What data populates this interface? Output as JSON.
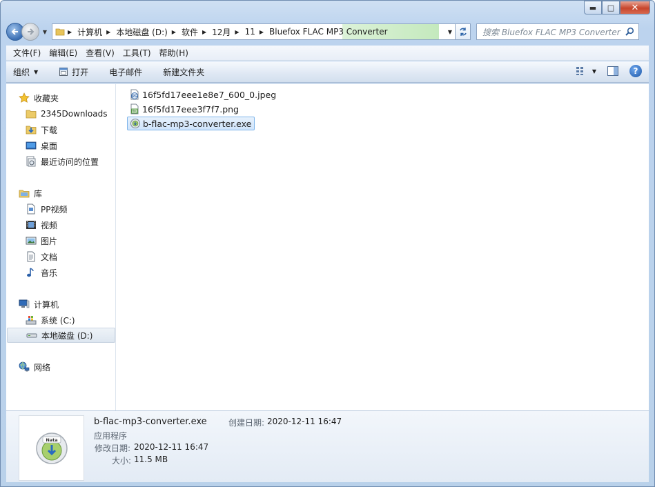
{
  "window": {
    "minimize": "▬",
    "maximize": "□",
    "close": "✕"
  },
  "address": {
    "crumbs": [
      "计算机",
      "本地磁盘 (D:)",
      "软件",
      "12月",
      "11",
      "Bluefox FLAC MP3 Converter"
    ]
  },
  "search": {
    "placeholder": "搜索 Bluefox FLAC MP3 Converter"
  },
  "menubar": {
    "file": "文件(F)",
    "edit": "编辑(E)",
    "view": "查看(V)",
    "tools": "工具(T)",
    "help": "帮助(H)"
  },
  "toolbar": {
    "organize": "组织",
    "open": "打开",
    "email": "电子邮件",
    "new_folder": "新建文件夹"
  },
  "navpane": {
    "favorites": "收藏夹",
    "fav_items": [
      "2345Downloads",
      "下载",
      "桌面",
      "最近访问的位置"
    ],
    "libraries": "库",
    "lib_items": [
      "PP视频",
      "视频",
      "图片",
      "文档",
      "音乐"
    ],
    "computer": "计算机",
    "comp_items": [
      "系统 (C:)",
      "本地磁盘 (D:)"
    ],
    "network": "网络"
  },
  "files": [
    {
      "name": "16f5fd17eee1e8e7_600_0.jpeg",
      "icon": "jpeg-file-icon"
    },
    {
      "name": "16f5fd17eee3f7f7.png",
      "icon": "png-file-icon"
    },
    {
      "name": "b-flac-mp3-converter.exe",
      "icon": "exe-file-icon"
    }
  ],
  "details": {
    "filename": "b-flac-mp3-converter.exe",
    "type": "应用程序",
    "created_label": "创建日期:",
    "created_value": "2020-12-11 16:47",
    "modified_label": "修改日期:",
    "modified_value": "2020-12-11 16:47",
    "size_label": "大小:",
    "size_value": "11.5 MB",
    "thumb_badge": "Nata"
  }
}
